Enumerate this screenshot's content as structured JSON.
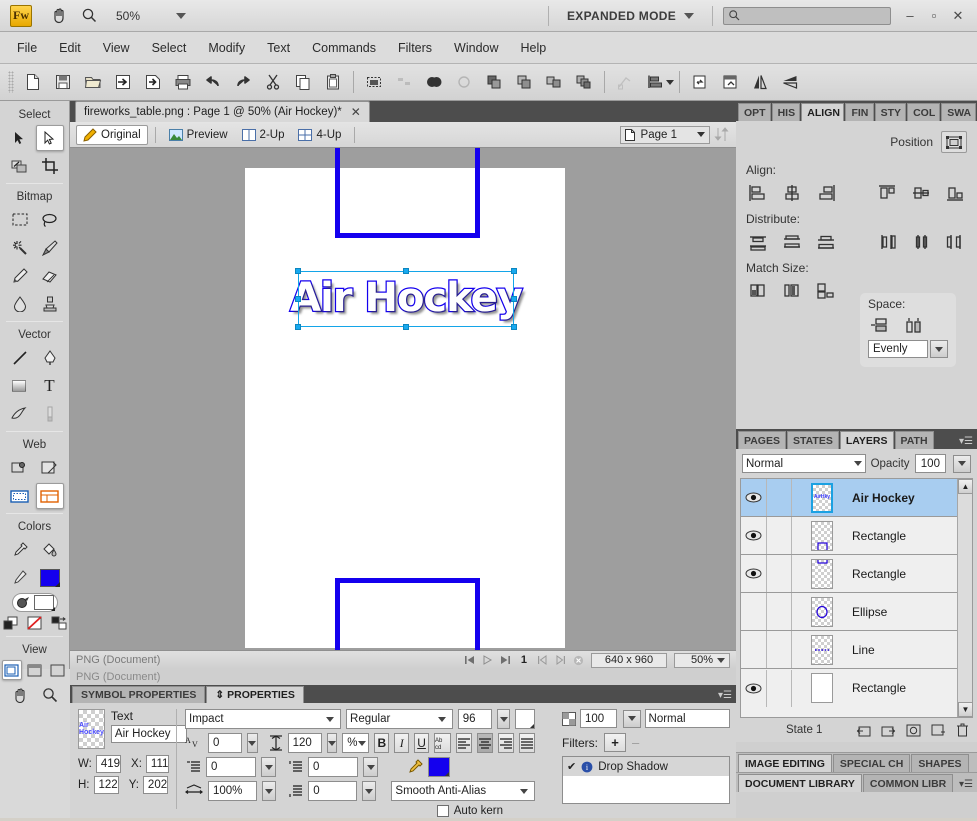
{
  "titlebar": {
    "logo": "Fw",
    "hand_icon": "hand-icon",
    "zoom_icon": "magnifier-icon",
    "zoom_value": "50%",
    "mode_label": "EXPANDED MODE",
    "search_placeholder": "",
    "search_value": "",
    "minimize": "–",
    "maximize": "▫",
    "close": "✕"
  },
  "menubar": {
    "items": [
      "File",
      "Edit",
      "View",
      "Select",
      "Modify",
      "Text",
      "Commands",
      "Filters",
      "Window",
      "Help"
    ]
  },
  "toolbar": {
    "buttons": [
      "new-document-icon",
      "save-icon",
      "open-folder-icon",
      "import-icon",
      "export-icon",
      "print-icon",
      "undo-icon",
      "redo-icon",
      "cut-icon",
      "copy-icon",
      "paste-icon",
      "select-all-icon",
      "deselect-icon",
      "union-icon",
      "subtract-icon",
      "intersect-icon",
      "group-icon",
      "ungroup-icon",
      "bring-forward-icon",
      "send-backward-icon",
      "rotate-icon",
      "distribute-icon",
      "rotate-90-cw-icon",
      "rotate-90-ccw-icon",
      "flip-horizontal-icon",
      "flip-vertical-icon"
    ]
  },
  "tools": {
    "groups": [
      {
        "title": "Select",
        "rows": [
          [
            "pointer-tool",
            "subselection-tool"
          ],
          [
            "scale-tool",
            "crop-tool"
          ]
        ]
      },
      {
        "title": "Bitmap",
        "rows": [
          [
            "marquee-tool",
            "lasso-tool"
          ],
          [
            "magic-wand-tool",
            "brush-tool"
          ],
          [
            "pencil-tool",
            "eraser-tool"
          ],
          [
            "blur-tool",
            "rubber-stamp-tool"
          ]
        ]
      },
      {
        "title": "Vector",
        "rows": [
          [
            "line-tool",
            "pen-tool"
          ],
          [
            "rectangle-tool",
            "text-tool"
          ],
          [
            "freeform-tool",
            "knife-tool"
          ]
        ]
      },
      {
        "title": "Web",
        "rows": [
          [
            "hotspot-tool",
            "slice-tool"
          ],
          [
            "hide-slices-tool",
            "show-slices-tool"
          ]
        ]
      },
      {
        "title": "Colors",
        "rows": [
          [
            "eyedropper-tool",
            "paint-bucket-tool"
          ],
          [
            "stroke-color-swatch",
            "fill-color-swatch"
          ],
          [
            "stroke-fill-swatch",
            "no-stroke-swatch"
          ],
          [
            "default-colors-icon",
            "no-fill-icon",
            "swap-colors-icon"
          ]
        ]
      },
      {
        "title": "View",
        "rows": [
          [
            "standard-screen-mode",
            "full-screen-with-menus",
            "full-screen-mode"
          ],
          [
            "hand-tool",
            "zoom-tool"
          ]
        ]
      }
    ],
    "selected": "subselection-tool"
  },
  "document": {
    "tab_title": "fireworks_table.png : Page 1 @  50% (Air Hockey)*",
    "tab_close": "✕",
    "views": [
      {
        "label": "Original",
        "icon": "pencil-icon",
        "active": true
      },
      {
        "label": "Preview",
        "icon": "image-icon",
        "active": false
      },
      {
        "label": "2-Up",
        "icon": "two-up-icon",
        "active": false
      },
      {
        "label": "4-Up",
        "icon": "four-up-icon",
        "active": false
      }
    ],
    "page_label": "Page 1",
    "page_icon": "page-icon",
    "sort_icon": "sort-updown-icon"
  },
  "canvas": {
    "art_text": "Air Hockey",
    "text_fill_color": "#ffffff",
    "text_stroke_color": "#1400ee",
    "shape_color": "#1400ee",
    "page_background": "#ffffff"
  },
  "statusbar": {
    "doc_type": "PNG (Document)",
    "first_icon": "first-frame-icon",
    "play_icon": "play-icon",
    "last_icon": "last-frame-icon",
    "frame": "1",
    "prev_icon": "prev-frame-icon",
    "next_icon": "next-frame-icon",
    "stop_icon": "stop-icon",
    "dimensions": "640 x 960",
    "zoom": "50%"
  },
  "right_panel": {
    "tabs": [
      {
        "label": "OPT",
        "active": false
      },
      {
        "label": "HIS",
        "active": false
      },
      {
        "label": "ALIGN",
        "active": true
      },
      {
        "label": "FIN",
        "active": false
      },
      {
        "label": "STY",
        "active": false
      },
      {
        "label": "COL",
        "active": false
      },
      {
        "label": "SWA",
        "active": false
      }
    ],
    "align": {
      "position_label": "Position",
      "position_icon": "position-icon",
      "align_label": "Align:",
      "align_icons": [
        "align-left-icon",
        "align-center-horizontal-icon",
        "align-right-icon",
        "align-top-icon",
        "align-middle-vertical-icon",
        "align-bottom-icon"
      ],
      "distribute_label": "Distribute:",
      "distribute_icons": [
        "distribute-top-icon",
        "distribute-center-vertical-icon",
        "distribute-bottom-icon",
        "distribute-left-icon",
        "distribute-center-horizontal-icon",
        "distribute-right-icon"
      ],
      "match_size_label": "Match Size:",
      "match_size_icons": [
        "match-height-icon",
        "match-width-icon",
        "match-both-icon"
      ],
      "space_label": "Space:",
      "space_icons": [
        "space-vertical-icon",
        "space-horizontal-icon"
      ],
      "space_value": "Evenly"
    }
  },
  "layers_panel": {
    "tabs": [
      {
        "label": "PAGES",
        "active": false
      },
      {
        "label": "STATES",
        "active": false
      },
      {
        "label": "LAYERS",
        "active": true
      },
      {
        "label": "PATH",
        "active": false
      }
    ],
    "menu_icon": "panel-menu-icon",
    "blend_mode": "Normal",
    "opacity_label": "Opacity",
    "opacity_value": "100",
    "rows": [
      {
        "name": "Air Hockey",
        "visible": true,
        "selected": true,
        "thumb": "text-thumb"
      },
      {
        "name": "Rectangle",
        "visible": true,
        "selected": false,
        "thumb": "rect-bottom-thumb"
      },
      {
        "name": "Rectangle",
        "visible": true,
        "selected": false,
        "thumb": "rect-top-thumb"
      },
      {
        "name": "Ellipse",
        "visible": false,
        "selected": false,
        "thumb": "ellipse-thumb"
      },
      {
        "name": "Line",
        "visible": false,
        "selected": false,
        "thumb": "line-thumb"
      },
      {
        "name": "Rectangle",
        "visible": true,
        "selected": false,
        "thumb": "solid-rect-thumb"
      }
    ],
    "footer": {
      "state_label": "State 1",
      "icons": [
        "new-sub-layer-icon",
        "new-layer-icon",
        "add-mask-icon",
        "duplicate-icon",
        "delete-icon"
      ]
    }
  },
  "bottom_panel_tabs": {
    "row1": [
      {
        "label": "IMAGE EDITING",
        "active": true
      },
      {
        "label": "SPECIAL CH",
        "active": false
      },
      {
        "label": "SHAPES",
        "active": false
      }
    ],
    "row2": [
      {
        "label": "DOCUMENT LIBRARY",
        "active": true
      },
      {
        "label": "COMMON LIBR",
        "active": false
      }
    ],
    "menu_icon": "panel-menu-icon"
  },
  "properties": {
    "tabs": [
      {
        "label": "SYMBOL PROPERTIES",
        "active": false
      },
      {
        "label": "PROPERTIES",
        "active": true
      }
    ],
    "object_type": "Text",
    "object_name": "Air Hockey",
    "thumb_text": "Air Hockey",
    "w_label": "W:",
    "w_value": "419",
    "h_label": "H:",
    "h_value": "122",
    "x_label": "X:",
    "x_value": "111",
    "y_label": "Y:",
    "y_value": "202",
    "font_family": "Impact",
    "font_style": "Regular",
    "font_size": "96",
    "kerning_icon": "kerning-icon",
    "kerning_value": "0",
    "leading_icon": "leading-icon",
    "leading_value": "120",
    "leading_unit": "%",
    "paragraph_indent_icon": "paragraph-indent-icon",
    "indent_value": "0",
    "space_before_icon": "space-before-icon",
    "space_before_value": "0",
    "horizontal_scale_icon": "horizontal-scale-icon",
    "horizontal_scale_value": "100%",
    "space_after_icon": "space-after-icon",
    "space_after_value": "0",
    "bold": "B",
    "italic": "I",
    "underline": "U",
    "orientation_icon": "text-orientation-icon",
    "align_left_icon": "text-align-left-icon",
    "align_center_icon": "text-align-center-icon",
    "align_right_icon": "text-align-right-icon",
    "align_justify_icon": "text-align-justify-icon",
    "active_alignment": "text-align-center-icon",
    "color_picker_icon": "text-color-eyedropper-icon",
    "text_color": "#1400ee",
    "antialias": "Smooth Anti-Alias",
    "auto_kern_label": "Auto kern",
    "auto_kern_checked": false,
    "opacity_icon": "opacity-checker-icon",
    "opacity_value": "100",
    "blend_mode": "Normal",
    "filters_label": "Filters:",
    "filters_add": "+",
    "filters_remove": "–",
    "filters": [
      {
        "name": "Drop Shadow",
        "enabled": true,
        "info_icon": "info-icon",
        "check": "✔"
      }
    ]
  }
}
